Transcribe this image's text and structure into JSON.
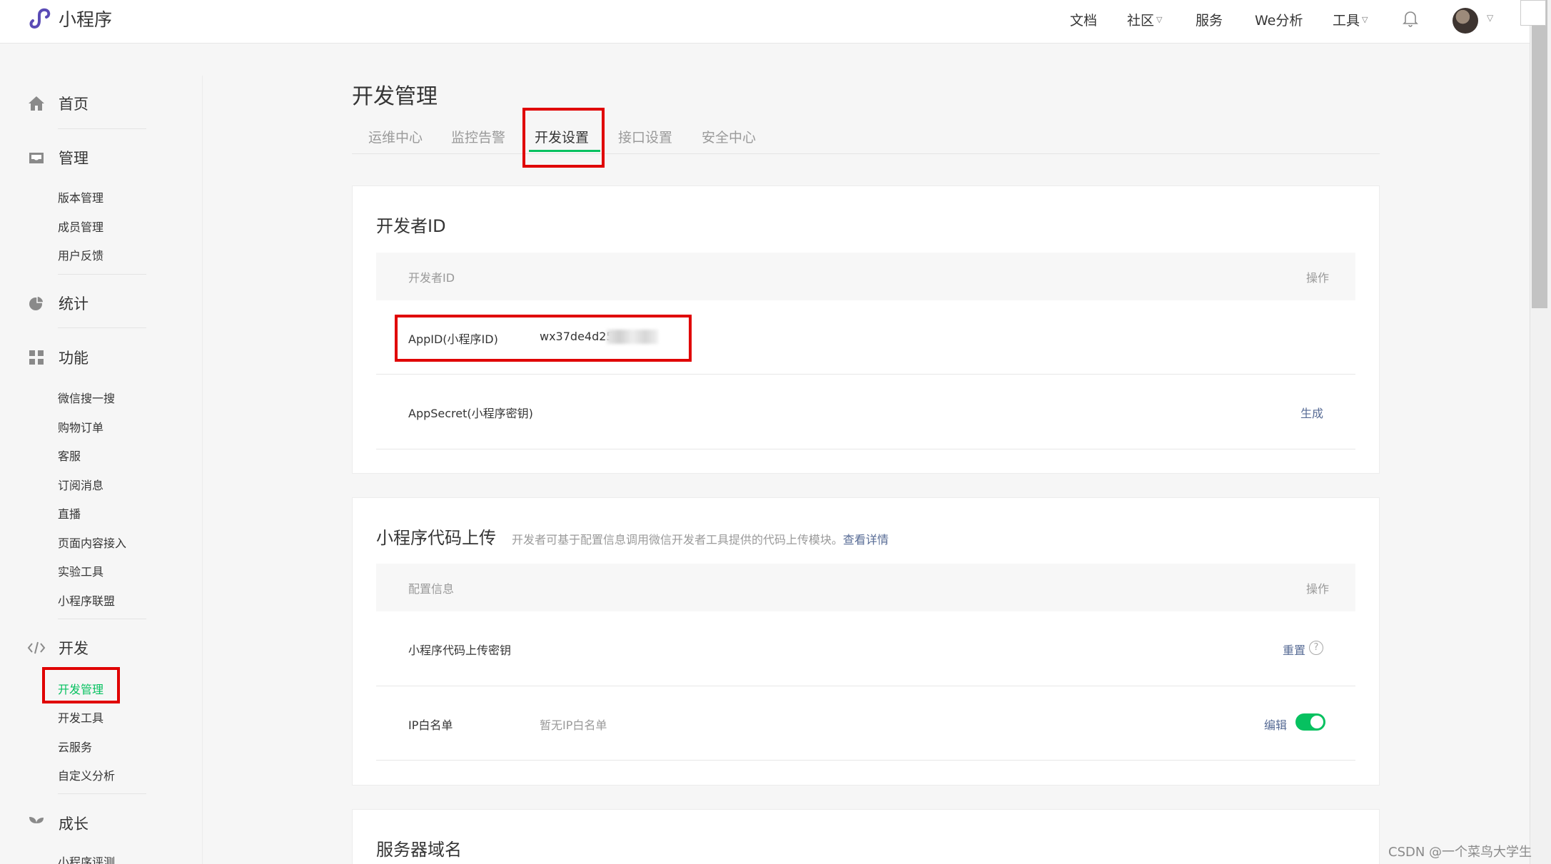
{
  "app": {
    "title": "小程序"
  },
  "topnav": {
    "docs": "文档",
    "community": "社区",
    "service": "服务",
    "we_analysis": "We分析",
    "tools": "工具"
  },
  "sidebar": {
    "home": "首页",
    "manage": {
      "label": "管理",
      "items": [
        "版本管理",
        "成员管理",
        "用户反馈"
      ]
    },
    "stats": "统计",
    "features": {
      "label": "功能",
      "items": [
        "微信搜一搜",
        "购物订单",
        "客服",
        "订阅消息",
        "直播",
        "页面内容接入",
        "实验工具",
        "小程序联盟"
      ]
    },
    "dev": {
      "label": "开发",
      "items": [
        "开发管理",
        "开发工具",
        "云服务",
        "自定义分析"
      ]
    },
    "growth": {
      "label": "成长",
      "items": [
        "小程序评测"
      ]
    }
  },
  "page": {
    "title": "开发管理",
    "tabs": [
      "运维中心",
      "监控告警",
      "开发设置",
      "接口设置",
      "安全中心"
    ]
  },
  "dev_id": {
    "title": "开发者ID",
    "col_name": "开发者ID",
    "col_action": "操作",
    "appid_label": "AppID(小程序ID)",
    "appid_value": "wx37de4d25",
    "secret_label": "AppSecret(小程序密钥)",
    "secret_action": "生成"
  },
  "code_upload": {
    "title": "小程序代码上传",
    "desc": "开发者可基于配置信息调用微信开发者工具提供的代码上传模块。",
    "desc_link": "查看详情",
    "col_name": "配置信息",
    "col_action": "操作",
    "key_label": "小程序代码上传密钥",
    "key_action": "重置",
    "ip_label": "IP白名单",
    "ip_value": "暂无IP白名单",
    "ip_action": "编辑"
  },
  "server_domain": {
    "title": "服务器域名"
  },
  "watermark": "CSDN @一个菜鸟大学生",
  "colors": {
    "accent": "#07c160",
    "link": "#576b95",
    "highlight": "#e00000"
  }
}
